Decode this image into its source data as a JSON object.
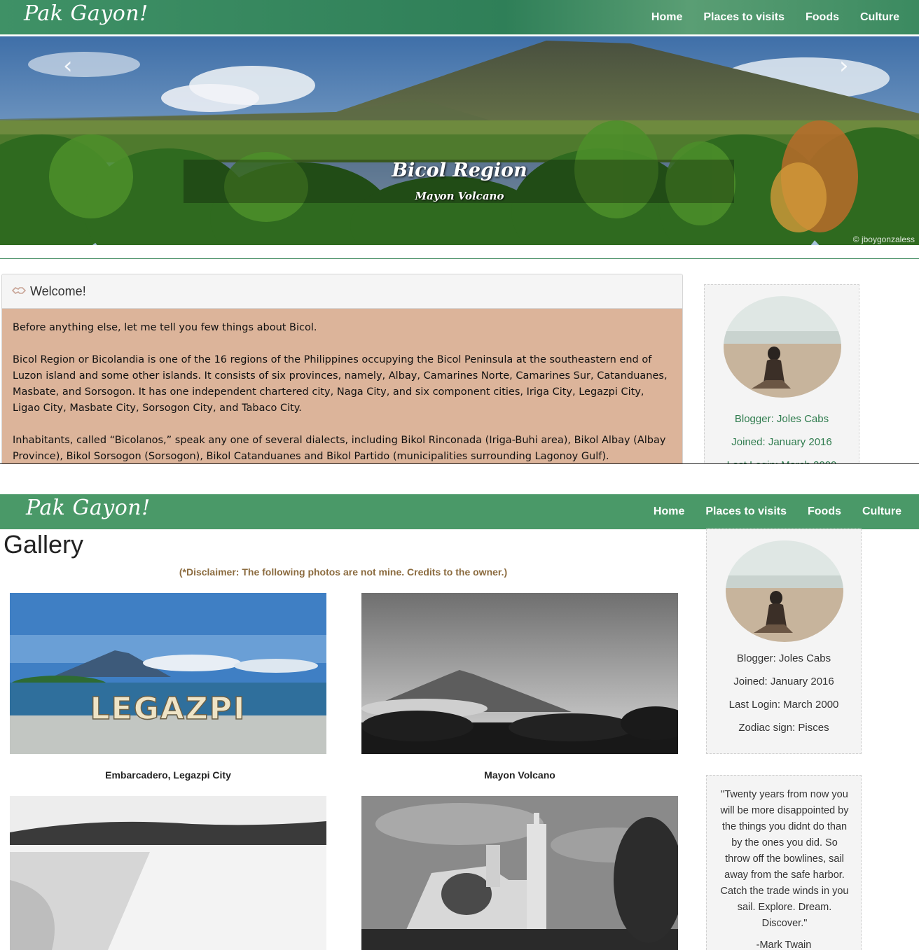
{
  "brand": "Pak Gayon!",
  "nav": {
    "home": "Home",
    "places": "Places to visits",
    "foods": "Foods",
    "culture": "Culture"
  },
  "carousel": {
    "title": "Bicol Region",
    "subtitle": "Mayon Volcano",
    "prev_icon": "‹",
    "next_icon": "›",
    "watermark": "© jboygonzaless"
  },
  "welcome": {
    "title": "Welcome!",
    "icon": "handshake-icon",
    "paragraphs": [
      "Before anything else, let me tell you few things about Bicol.",
      "Bicol Region or Bicolandia is one of the 16 regions of the Philippines occupying the Bicol Peninsula at the southeastern end of Luzon island and some other islands. It consists of six provinces, namely, Albay, Camarines Norte, Camarines Sur, Catanduanes, Masbate, and Sorsogon. It has one independent chartered city, Naga City, and six component cities, Iriga City, Legazpi City, Ligao City, Masbate City, Sorsogon City, and Tabaco City.",
      "Inhabitants, called “Bicolanos,” speak any one of several dialects, including Bikol Rinconada (Iriga-Buhi area), Bikol Albay (Albay Province), Bikol Sorsogon (Sorsogon), Bikol Catanduanes and Bikol Partido (municipalities surrounding Lagonoy Gulf)."
    ]
  },
  "profile": {
    "blogger": "Blogger: Joles Cabs",
    "joined": "Joined: January 2016",
    "last_login": "Last Login: March 2000",
    "zodiac": "Zodiac sign: Pisces"
  },
  "gallery": {
    "title": "Gallery",
    "disclaimer": "(*Disclaimer: The following photos are not mine. Credits to the owner.)",
    "legazpi_sign": "LEGAZPI",
    "captions": [
      "Embarcadero, Legazpi City",
      "Mayon Volcano"
    ]
  },
  "quote": {
    "text": "\"Twenty years from now you will be more disappointed by the things you didnt do than by the ones you did. So throw off the bowlines, sail away from the safe harbor. Catch the trade winds in you sail. Explore. Dream. Discover.\"",
    "author": "-Mark Twain"
  }
}
